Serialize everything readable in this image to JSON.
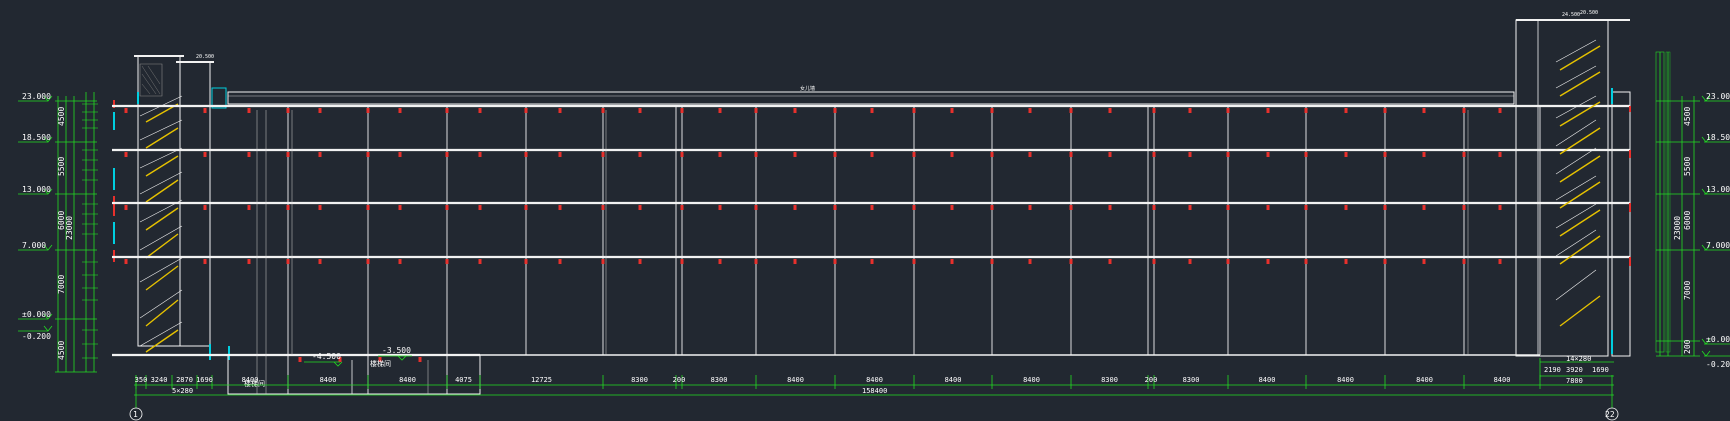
{
  "colors": {
    "background": "#222831",
    "structure": "#f2f2f2",
    "columns": "#e8302c",
    "stairs": "#e6c200",
    "dimensions": "#22dd22",
    "highlight": "#00cfe0",
    "text": "#ffffff"
  },
  "levels_left": [
    {
      "label": "23.000"
    },
    {
      "label": "18.500"
    },
    {
      "label": "13.000"
    },
    {
      "label": "7.000"
    },
    {
      "label": "±0.000"
    },
    {
      "label": "-0.200"
    }
  ],
  "levels_right": [
    {
      "label": "23.000"
    },
    {
      "label": "18.500"
    },
    {
      "label": "13.000"
    },
    {
      "label": "7.000"
    },
    {
      "label": "±0.000"
    },
    {
      "label": "-0.200"
    }
  ],
  "story_heights_left": [
    "4500",
    "5500",
    "6000",
    "7000",
    "4500"
  ],
  "total_height_left": "23000",
  "story_heights_right": [
    "4500",
    "5500",
    "6000",
    "7000",
    "200"
  ],
  "total_height_right": "23000",
  "bottom_dimensions": [
    "350",
    "3240",
    "2870",
    "1690",
    "8400",
    "8400",
    "8400",
    "4075",
    "12725",
    "8300",
    "200",
    "8300",
    "8400",
    "8400",
    "8400",
    "8400",
    "8300",
    "200",
    "8300",
    "8400",
    "8400",
    "8400",
    "8400"
  ],
  "bottom_sub_label_left": "5×280",
  "total_length": "158400",
  "right_top_label": "14×280",
  "right_dimensions": [
    "2190",
    "3920",
    "1690"
  ],
  "right_total": "7800",
  "axis_start": "1",
  "axis_end": "22",
  "basement_levels": [
    "-4.500",
    "-3.500"
  ],
  "room_labels": [
    "楼梯间",
    "楼梯间"
  ],
  "roof_label": "女儿墙",
  "small_annotations": [
    "20.500",
    "24.500",
    "20.500"
  ]
}
